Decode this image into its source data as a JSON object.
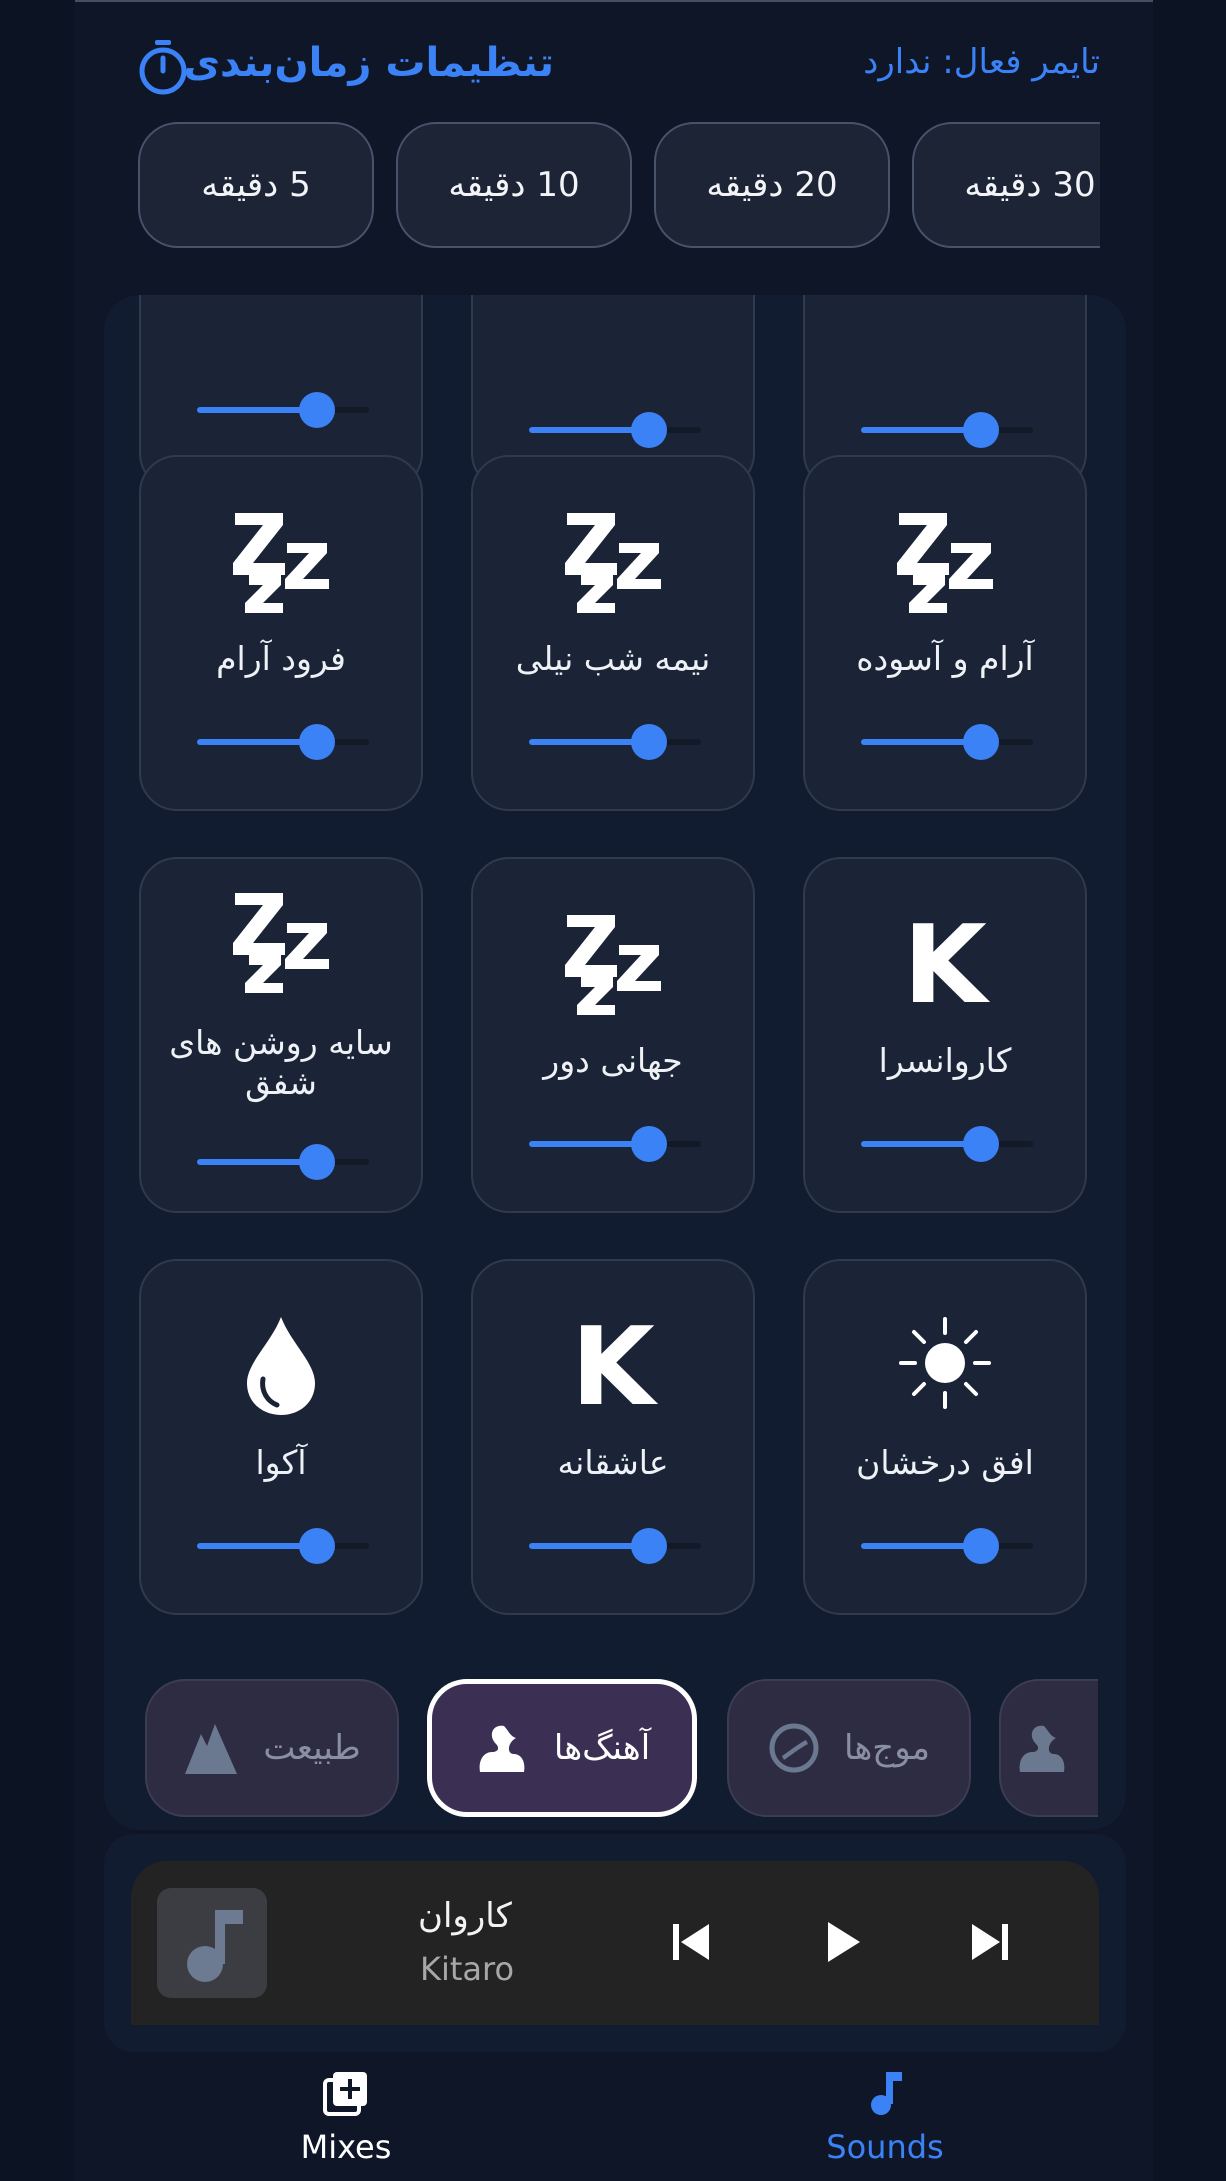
{
  "header": {
    "title": "تنظیمات زمان‌بندی",
    "active_timer": "تایمر فعال: ندارد"
  },
  "timer_chips": [
    "5 دقیقه",
    "10 دقیقه",
    "20 دقیقه",
    "30 دقیقه"
  ],
  "sounds": [
    {
      "label": "",
      "icon": "slider-only",
      "volume": 0.7
    },
    {
      "label": "",
      "icon": "slider-only",
      "volume": 0.7
    },
    {
      "label": "",
      "icon": "slider-only",
      "volume": 0.7
    },
    {
      "label": "فرود آرام",
      "icon": "sleep-zzz-icon",
      "volume": 0.7
    },
    {
      "label": "نیمه شب نیلی",
      "icon": "sleep-zzz-icon",
      "volume": 0.7
    },
    {
      "label": "آرام و آسوده",
      "icon": "sleep-zzz-icon",
      "volume": 0.7
    },
    {
      "label": "سایه روشن های شفق",
      "icon": "sleep-zzz-icon",
      "volume": 0.7
    },
    {
      "label": "جهانی دور",
      "icon": "sleep-zzz-icon",
      "volume": 0.7
    },
    {
      "label": "کاروانسرا",
      "icon": "k-letter-icon",
      "icon_text": "K",
      "volume": 0.7
    },
    {
      "label": "آکوا",
      "icon": "water-drop-icon",
      "volume": 0.7
    },
    {
      "label": "عاشقانه",
      "icon": "k-letter-icon",
      "icon_text": "K",
      "volume": 0.7
    },
    {
      "label": "افق درخشان",
      "icon": "sun-icon",
      "volume": 0.7
    }
  ],
  "categories": [
    {
      "label": "طبیعت",
      "icon": "mountain-icon",
      "active": false
    },
    {
      "label": "آهنگ‌ها",
      "icon": "swan-icon",
      "active": true
    },
    {
      "label": "موج‌ها",
      "icon": "wave-circle-icon",
      "active": false
    },
    {
      "label": "",
      "icon": "swan-icon",
      "active": false
    }
  ],
  "player": {
    "title": "کاروان",
    "artist": "Kitaro",
    "art_icon": "music-note-icon"
  },
  "nav": {
    "mixes": "Mixes",
    "sounds": "Sounds"
  },
  "colors": {
    "accent": "#3b82f6",
    "background": "#0e1628",
    "tile": "#1b2436",
    "active_category": "#3b2f54"
  }
}
